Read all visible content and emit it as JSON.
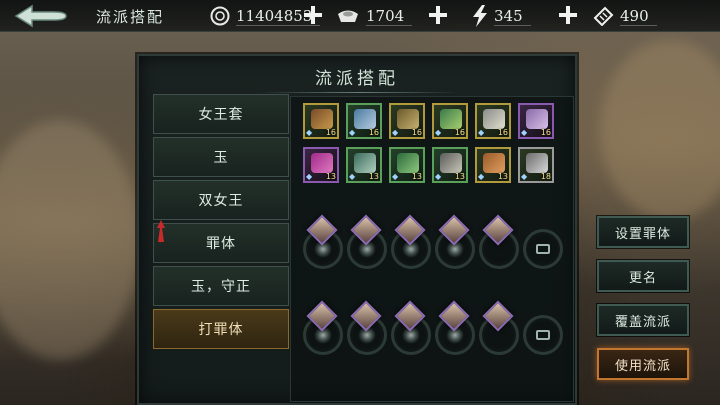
{
  "topbar": {
    "title": "流派搭配",
    "currencies": [
      {
        "icon": "coin-icon",
        "value": "11404853"
      },
      {
        "icon": "silver-ingot-icon",
        "value": "1704"
      },
      {
        "icon": "lightning-stamina-icon",
        "value": "345"
      },
      {
        "icon": "ticket-icon",
        "value": "490"
      }
    ]
  },
  "panel": {
    "title": "流派搭配",
    "loadouts": [
      {
        "label": "女王套",
        "active": false
      },
      {
        "label": "玉",
        "active": false
      },
      {
        "label": "双女王",
        "active": false
      },
      {
        "label": "罪体",
        "active": false
      },
      {
        "label": "玉，守正",
        "active": false
      },
      {
        "label": "打罪体",
        "active": true
      }
    ],
    "equipment_row1": [
      {
        "level": "16",
        "border": "gold"
      },
      {
        "level": "16",
        "border": "green"
      },
      {
        "level": "16",
        "border": "gold"
      },
      {
        "level": "16",
        "border": "gold"
      },
      {
        "level": "16",
        "border": "gold"
      },
      {
        "level": "16",
        "border": "purple"
      }
    ],
    "equipment_row2": [
      {
        "level": "13",
        "border": "gold"
      },
      {
        "level": "13",
        "border": "green"
      },
      {
        "level": "13",
        "border": "green"
      },
      {
        "level": "13",
        "border": "green"
      },
      {
        "level": "13",
        "border": "gold"
      },
      {
        "level": "18",
        "border": "gold"
      }
    ]
  },
  "side_buttons": {
    "set_label": "设置罪体",
    "rename_label": "更名",
    "overwrite_label": "覆盖流派",
    "use_label": "使用流派"
  },
  "colors": {
    "accent_active": "#c2762e",
    "panel_bg": "#141b1b",
    "text": "#dcebe1"
  }
}
